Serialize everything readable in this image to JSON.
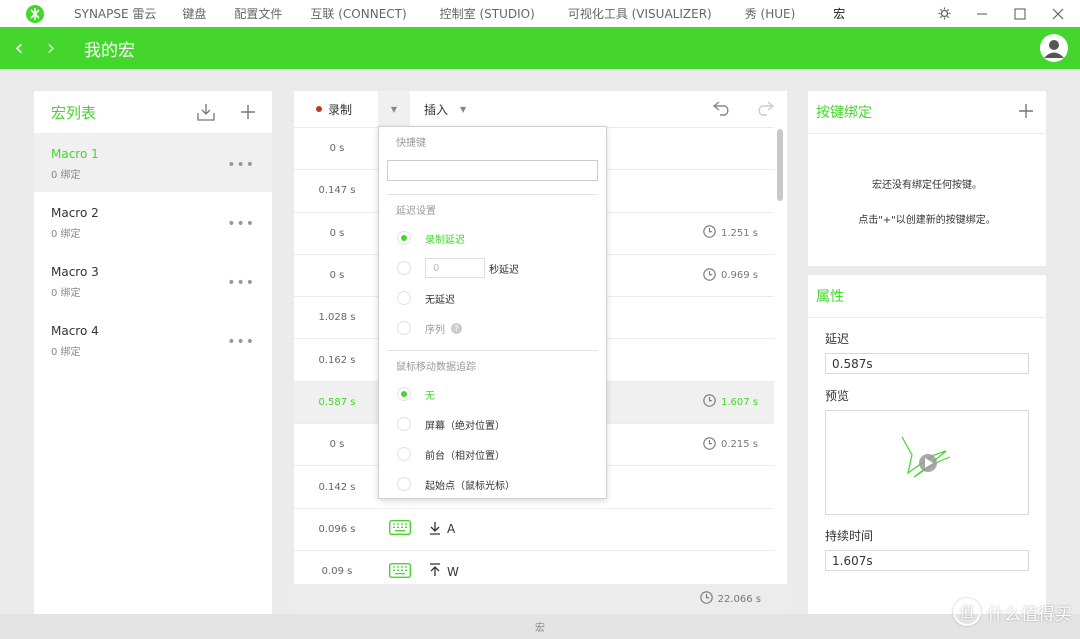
{
  "nav": {
    "items": [
      "SYNAPSE 雷云",
      "键盘",
      "配置文件",
      "互联 (CONNECT)",
      "控制室 (STUDIO)",
      "可视化工具 (VISUALIZER)",
      "秀 (HUE)",
      "宏"
    ],
    "active_index": 7
  },
  "header": {
    "title": "我的宏"
  },
  "macro_list": {
    "title": "宏列表",
    "items": [
      {
        "name": "Macro 1",
        "bindings": "0 绑定",
        "selected": true
      },
      {
        "name": "Macro 2",
        "bindings": "0 绑定"
      },
      {
        "name": "Macro 3",
        "bindings": "0 绑定"
      },
      {
        "name": "Macro 4",
        "bindings": "0 绑定"
      }
    ],
    "more": "•••"
  },
  "editor": {
    "record_label": "录制",
    "insert_label": "插入",
    "rows": [
      {
        "delay": "0 s",
        "duration": ""
      },
      {
        "delay": "0.147 s",
        "duration": ""
      },
      {
        "delay": "0 s",
        "duration": "1.251 s"
      },
      {
        "delay": "0 s",
        "duration": "0.969 s"
      },
      {
        "delay": "1.028 s",
        "duration": ""
      },
      {
        "delay": "0.162 s",
        "duration": ""
      },
      {
        "delay": "0.587 s",
        "duration": "1.607 s",
        "highlight": true
      },
      {
        "delay": "0 s",
        "duration": "0.215 s"
      },
      {
        "delay": "0.142 s",
        "duration": ""
      },
      {
        "delay": "0.096 s",
        "duration": "",
        "key": "A",
        "direction": "down"
      },
      {
        "delay": "0.09 s",
        "duration": "",
        "key": "W",
        "direction": "up"
      }
    ],
    "total": "22.066 s"
  },
  "record_menu": {
    "shortcut_label": "快捷键",
    "delay_section": "延迟设置",
    "delay_options": {
      "record_delay": "录制延迟",
      "seconds_value": "0",
      "seconds_suffix": "秒延迟",
      "no_delay": "无延迟",
      "sequence": "序列",
      "help": "?"
    },
    "mouse_section": "鼠标移动数据追踪",
    "mouse_options": [
      "无",
      "屏幕（绝对位置）",
      "前台（相对位置）",
      "起始点（鼠标光标）"
    ]
  },
  "key_binding": {
    "title": "按键绑定",
    "line1": "宏还没有绑定任何按键。",
    "line2": "点击\"+\"以创建新的按键绑定。"
  },
  "properties": {
    "title": "属性",
    "delay_label": "延迟",
    "delay_value": "0.587s",
    "preview_label": "预览",
    "duration_label": "持续时间",
    "duration_value": "1.607s"
  },
  "footer": {
    "label": "宏"
  },
  "watermark": {
    "text": "什么值得买",
    "badge": "值"
  },
  "colors": {
    "accent": "#44d62c",
    "record": "#c0392b"
  }
}
